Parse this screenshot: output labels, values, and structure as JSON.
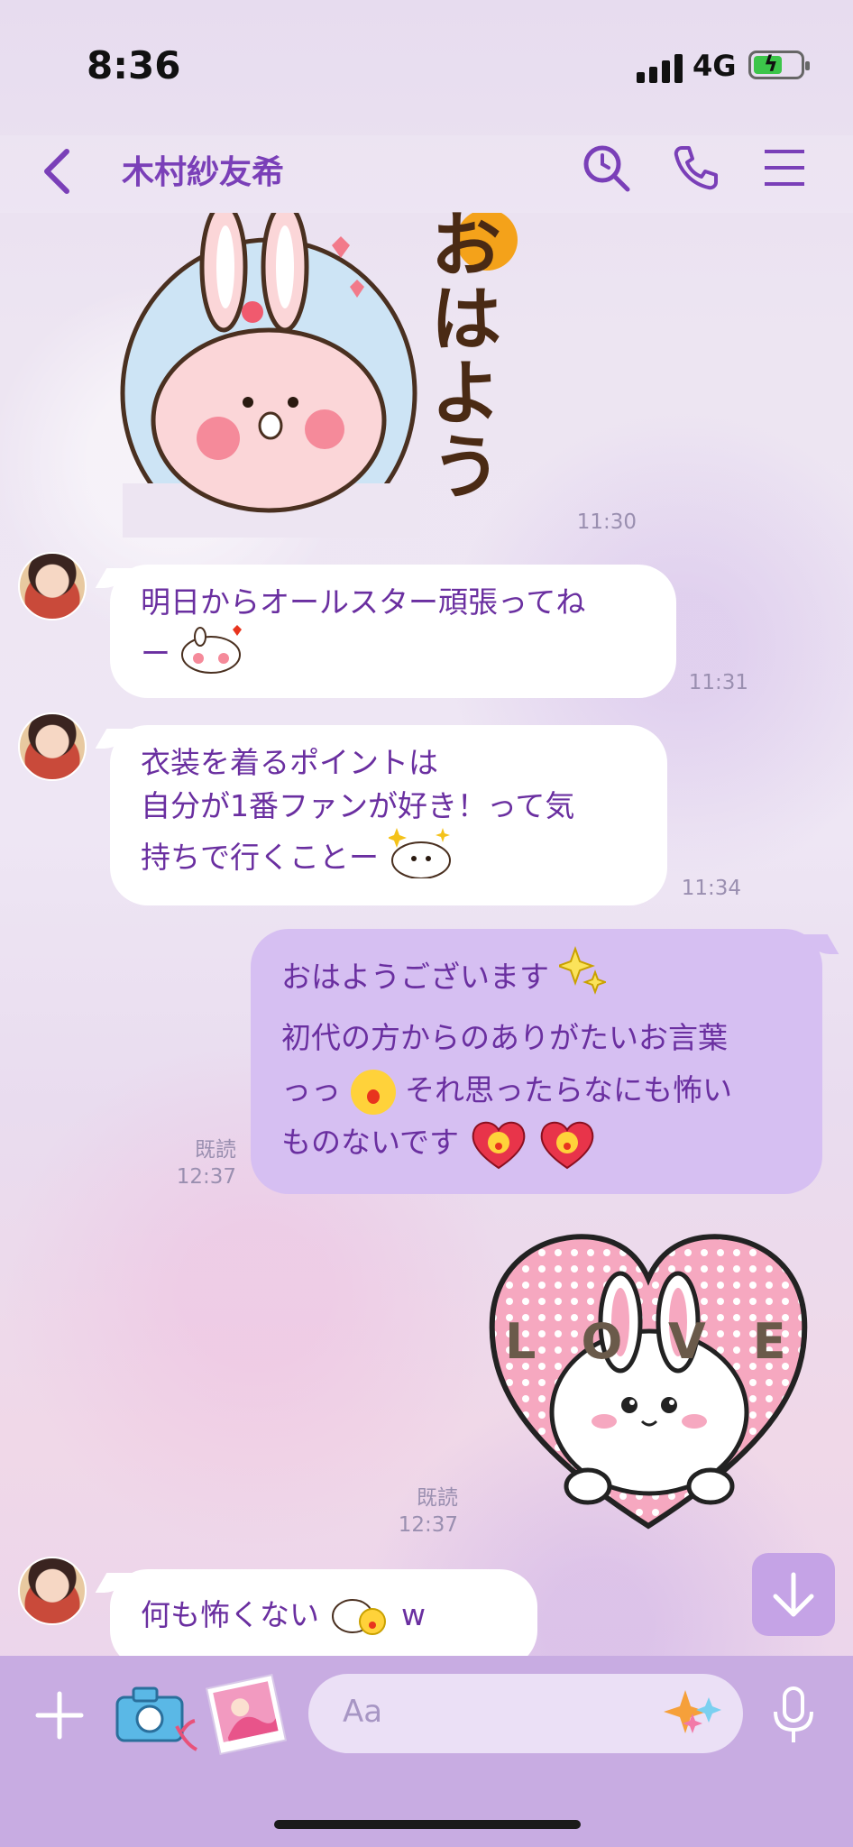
{
  "status_bar": {
    "time": "8:36",
    "network": "4G",
    "battery_level": 0.6
  },
  "header": {
    "title": "木村紗友希"
  },
  "messages": [
    {
      "type": "sticker",
      "sender": "other",
      "caption": "おはよう",
      "time": "11:30"
    },
    {
      "type": "text",
      "sender": "other",
      "lines": [
        "明日からオールスター頑張ってね",
        "ー"
      ],
      "time": "11:31"
    },
    {
      "type": "text",
      "sender": "other",
      "lines": [
        "衣装を着るポイントは",
        "自分が1番ファンが好き！って気",
        "持ちで行くことー"
      ],
      "time": "11:34"
    },
    {
      "type": "text",
      "sender": "me",
      "lines": [
        "おはようございます",
        "初代の方からのありがたいお言葉",
        "っっ",
        "それ思ったらなにも怖い",
        "ものないです"
      ],
      "read": "既読",
      "time": "12:37"
    },
    {
      "type": "sticker",
      "sender": "me",
      "caption": "LOVE",
      "read": "既読",
      "time": "12:37"
    },
    {
      "type": "text",
      "sender": "other",
      "lines": [
        "何も怖くない",
        "w"
      ]
    }
  ],
  "input": {
    "placeholder": "Aa"
  },
  "colors": {
    "accent": "#7a3fb8",
    "my_bubble": "#d6bff2",
    "input_bar": "#c8ace2"
  },
  "icons": [
    "back-chevron-icon",
    "search-icon",
    "phone-icon",
    "menu-icon",
    "plus-icon",
    "camera-icon",
    "photo-icon",
    "emoji-effect-icon",
    "microphone-icon",
    "arrow-down-icon"
  ]
}
